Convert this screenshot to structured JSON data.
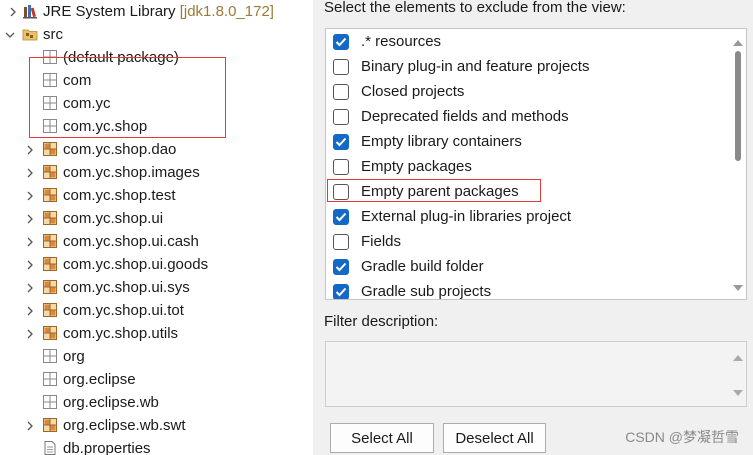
{
  "tree": {
    "library": {
      "label": "JRE System Library",
      "decoration": "[jdk1.8.0_172]",
      "icon": "library-icon"
    },
    "src": {
      "label": "src",
      "icon": "source-folder-icon"
    },
    "items": [
      {
        "label": "(default package)",
        "icon": "empty-package-icon",
        "expandable": false
      },
      {
        "label": "com",
        "icon": "empty-package-icon",
        "expandable": false
      },
      {
        "label": "com.yc",
        "icon": "empty-package-icon",
        "expandable": false
      },
      {
        "label": "com.yc.shop",
        "icon": "empty-package-icon",
        "expandable": false
      },
      {
        "label": "com.yc.shop.dao",
        "icon": "package-icon",
        "expandable": true
      },
      {
        "label": "com.yc.shop.images",
        "icon": "package-icon",
        "expandable": true
      },
      {
        "label": "com.yc.shop.test",
        "icon": "package-icon",
        "expandable": true
      },
      {
        "label": "com.yc.shop.ui",
        "icon": "package-icon",
        "expandable": true
      },
      {
        "label": "com.yc.shop.ui.cash",
        "icon": "package-icon",
        "expandable": true
      },
      {
        "label": "com.yc.shop.ui.goods",
        "icon": "package-icon",
        "expandable": true
      },
      {
        "label": "com.yc.shop.ui.sys",
        "icon": "package-icon",
        "expandable": true
      },
      {
        "label": "com.yc.shop.ui.tot",
        "icon": "package-icon",
        "expandable": true
      },
      {
        "label": "com.yc.shop.utils",
        "icon": "package-icon",
        "expandable": true
      },
      {
        "label": "org",
        "icon": "empty-package-icon",
        "expandable": false
      },
      {
        "label": "org.eclipse",
        "icon": "empty-package-icon",
        "expandable": false
      },
      {
        "label": "org.eclipse.wb",
        "icon": "empty-package-icon",
        "expandable": false
      },
      {
        "label": "org.eclipse.wb.swt",
        "icon": "package-icon",
        "expandable": true
      },
      {
        "label": "db.properties",
        "icon": "file-icon",
        "expandable": false
      }
    ]
  },
  "dialog": {
    "title": "Select the elements to exclude from the view:",
    "filters": [
      {
        "label": ".* resources",
        "checked": true
      },
      {
        "label": "Binary plug-in and feature projects",
        "checked": false
      },
      {
        "label": "Closed projects",
        "checked": false
      },
      {
        "label": "Deprecated fields and methods",
        "checked": false
      },
      {
        "label": "Empty library containers",
        "checked": true
      },
      {
        "label": "Empty packages",
        "checked": false
      },
      {
        "label": "Empty parent packages",
        "checked": false
      },
      {
        "label": "External plug-in libraries project",
        "checked": true
      },
      {
        "label": "Fields",
        "checked": false
      },
      {
        "label": "Gradle build folder",
        "checked": true
      },
      {
        "label": "Gradle sub projects",
        "checked": true
      }
    ],
    "filter_description_label": "Filter description:",
    "filter_description_value": "",
    "select_all_label": "Select All",
    "deselect_all_label": "Deselect All"
  },
  "watermark": "CSDN @梦凝哲雪",
  "colors": {
    "checkbox_on": "#1469c7",
    "highlight_border": "#e23a3a"
  }
}
